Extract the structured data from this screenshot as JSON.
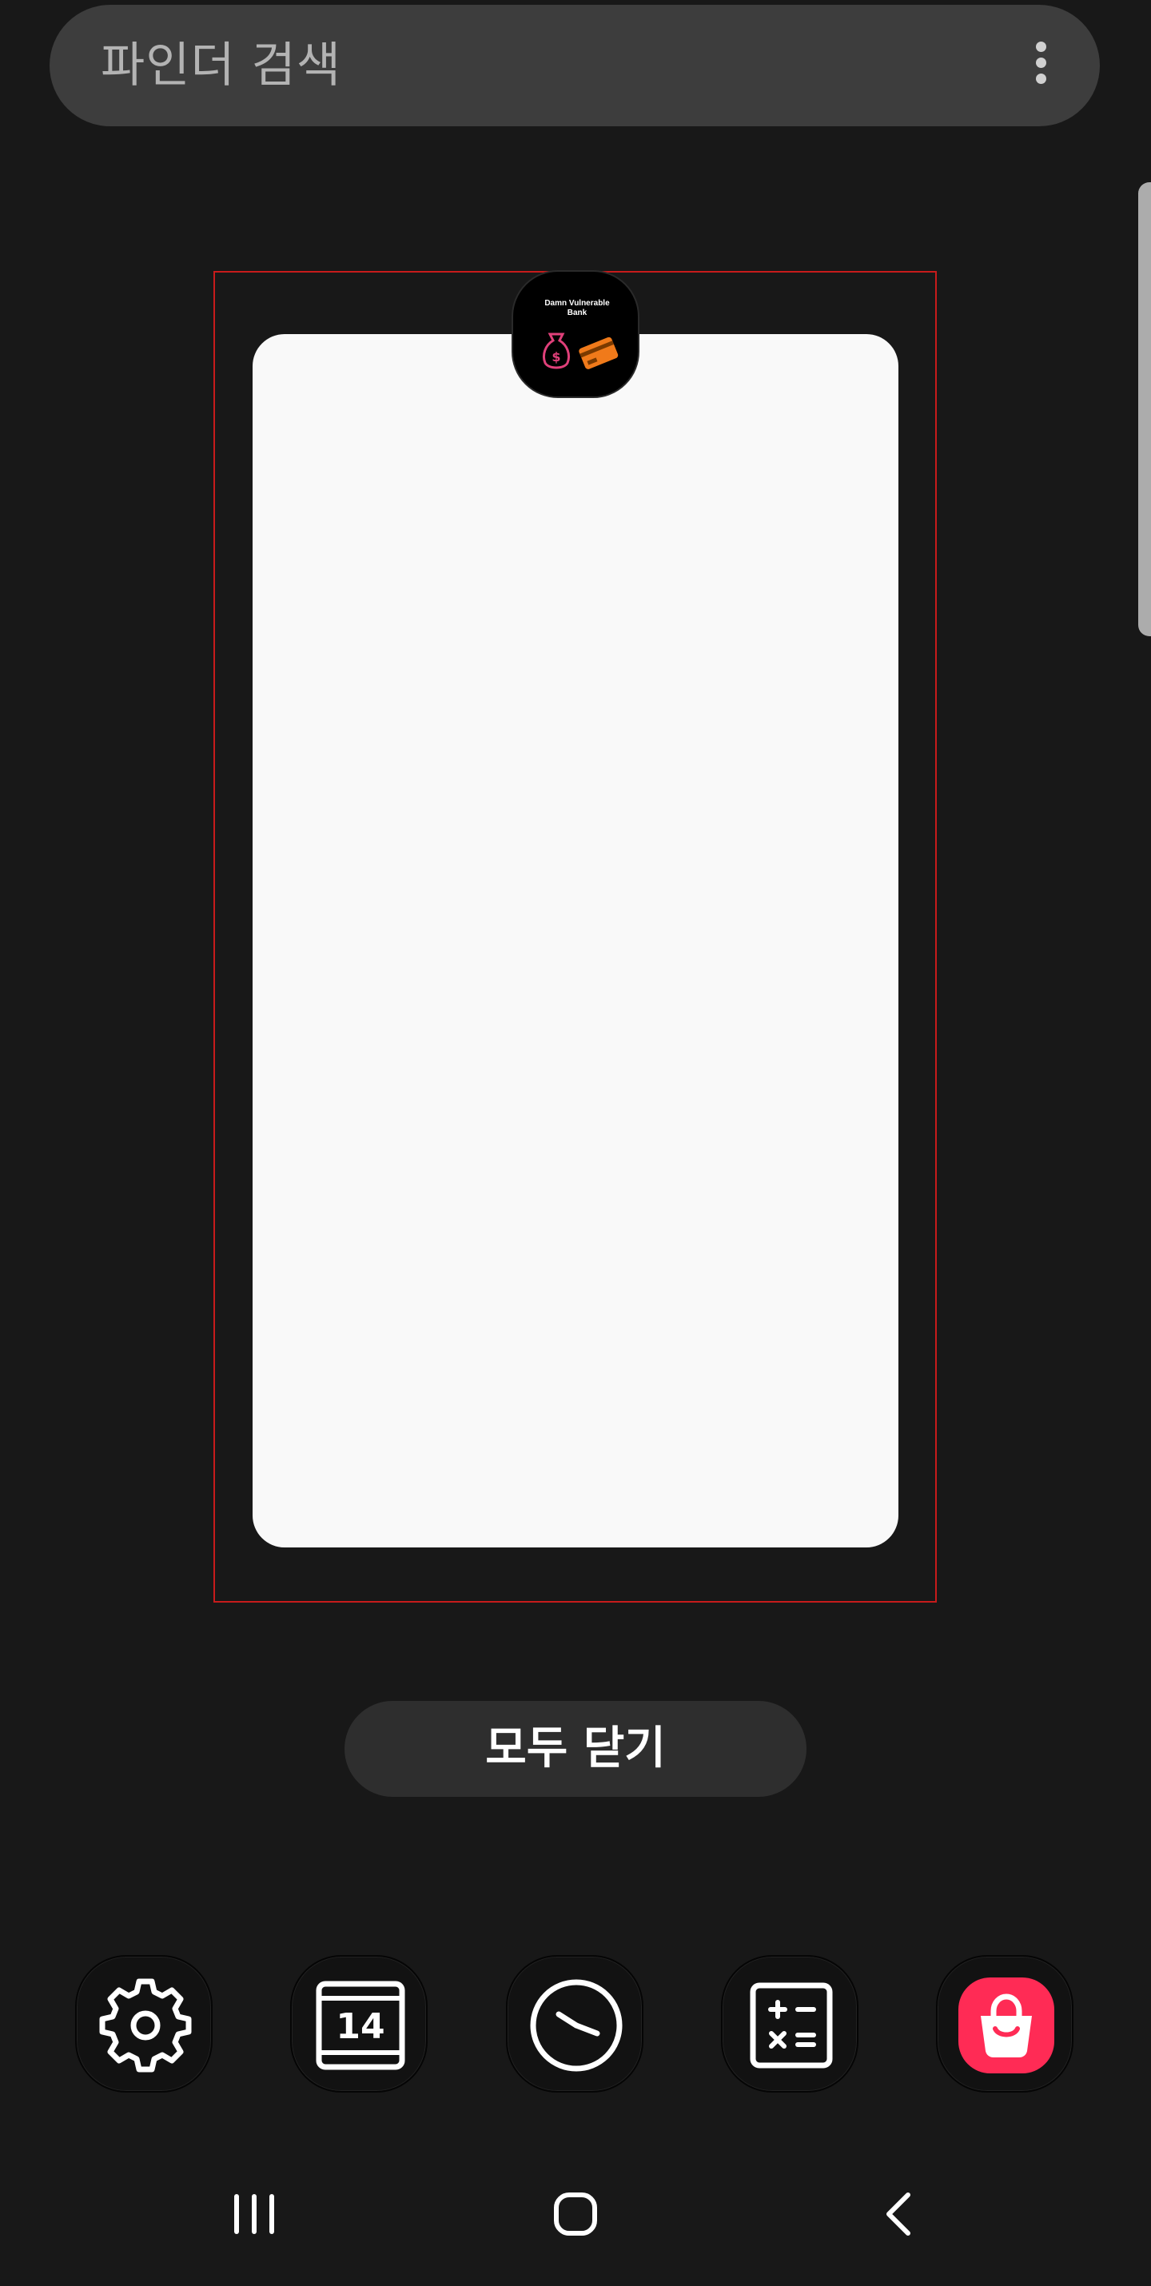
{
  "search": {
    "placeholder": "파인더 검색",
    "more_icon": "more-vertical-icon"
  },
  "recent_app": {
    "icon_text_line1": "Damn Vulnerable",
    "icon_text_line2": "Bank",
    "icon": "damn-vulnerable-bank-icon"
  },
  "close_all_label": "모두 닫기",
  "dock": {
    "apps": [
      {
        "icon": "settings-icon"
      },
      {
        "icon": "calendar-icon",
        "day": "14"
      },
      {
        "icon": "clock-icon"
      },
      {
        "icon": "calculator-icon"
      },
      {
        "icon": "galaxy-store-icon"
      }
    ]
  },
  "navigation": {
    "recents": "recents-icon",
    "home": "home-icon",
    "back": "back-icon"
  },
  "colors": {
    "background": "#181818",
    "search_bar": "#3d3d3d",
    "selection_outline": "#c71b1b",
    "store_accent": "#ff2b55"
  }
}
